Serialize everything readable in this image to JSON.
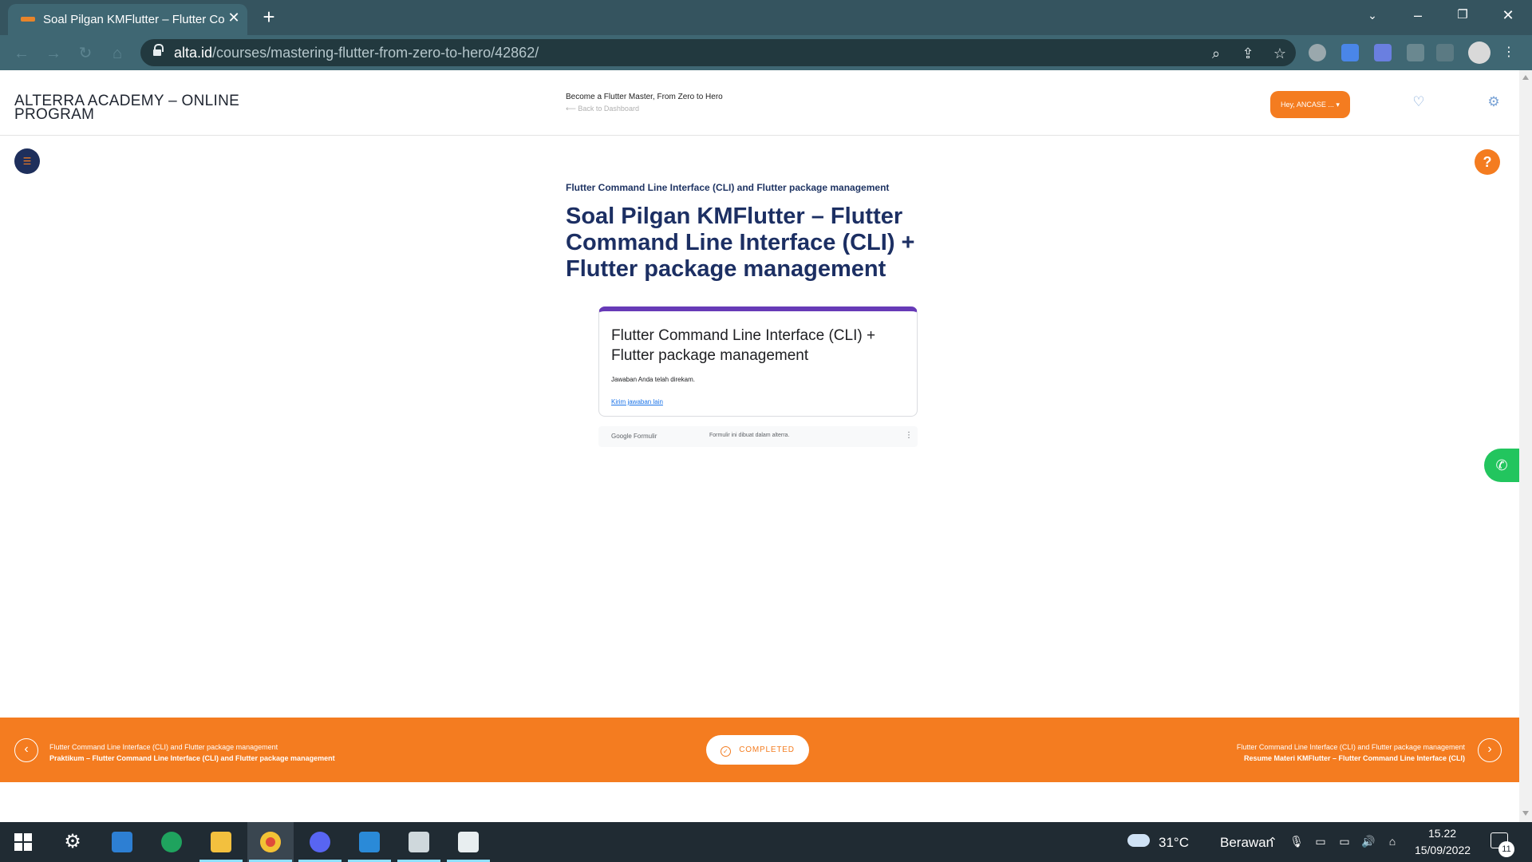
{
  "browser": {
    "tab_title": "Soal Pilgan KMFlutter – Flutter Command Line Interface (CLI) + Flutter package management",
    "url_domain": "alta.id",
    "url_path": "/courses/mastering-flutter-from-zero-to-hero/42862/"
  },
  "header": {
    "brand": "ALTERRA ACADEMY – ONLINE PROGRAM",
    "course_title": "Become a Flutter Master, From Zero to Hero",
    "back_link": "Back to Dashboard",
    "user_button": "Hey, ANCASE ...",
    "accent_color": "#f47c20"
  },
  "lesson": {
    "breadcrumb": "Flutter Command Line Interface (CLI) and Flutter package management",
    "title": "Soal Pilgan KMFlutter – Flutter Command Line Interface (CLI) + Flutter package management"
  },
  "form": {
    "title": "Flutter Command Line Interface (CLI) + Flutter package management",
    "message": "Jawaban Anda telah direkam.",
    "link": "Kirim jawaban lain",
    "footer_logo": "Google Formulir",
    "footer_note": "Formulir ini dibuat dalam alterra."
  },
  "navigation": {
    "prev_section": "Flutter Command Line Interface (CLI) and Flutter package management",
    "prev_lesson": "Praktikum – Flutter Command Line Interface (CLI) and Flutter package management",
    "next_section": "Flutter Command Line Interface (CLI) and Flutter package management",
    "next_lesson": "Resume Materi KMFlutter – Flutter Command Line Interface (CLI)",
    "complete_label": "COMPLETED"
  },
  "taskbar": {
    "temperature": "31°C",
    "weather": "Berawan",
    "time": "15.22",
    "date": "15/09/2022",
    "notifications": "11"
  }
}
